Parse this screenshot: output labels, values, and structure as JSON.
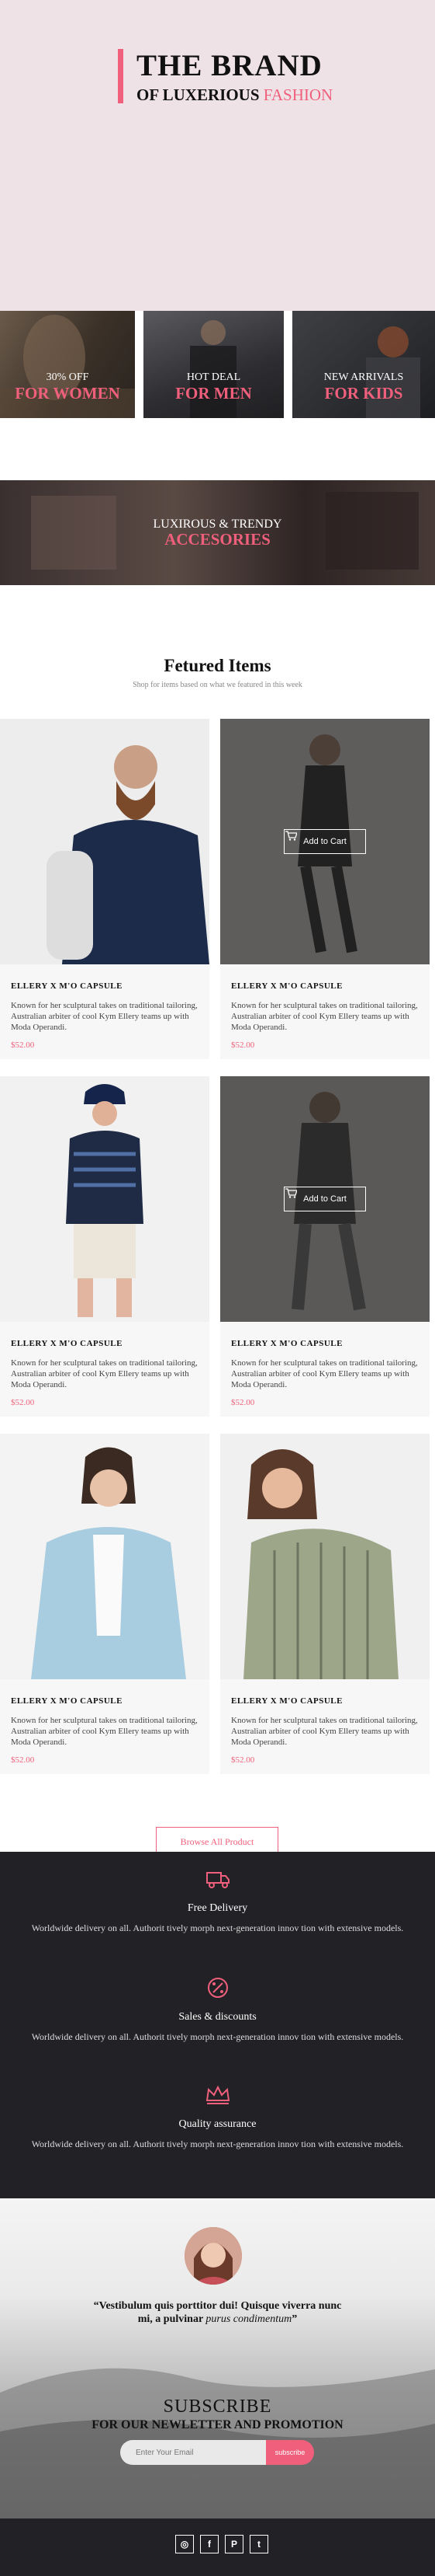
{
  "brand": {
    "title": "THE BRAND",
    "subtitle_prefix": "OF LUXERIOUS ",
    "subtitle_accent": "FASHION"
  },
  "promos": [
    {
      "small": "30% OFF",
      "large": "FOR WOMEN"
    },
    {
      "small": "HOT DEAL",
      "large": "FOR MEN"
    },
    {
      "small": "NEW ARRIVALS",
      "large": "FOR KIDS"
    },
    {
      "small": "LUXIROUS & TRENDY",
      "large": "ACCESORIES"
    }
  ],
  "featured": {
    "title": "Fetured Items",
    "subtitle": "Shop for items based on what we featured in this week"
  },
  "products": [
    {
      "title": "ELLERY X M'O CAPSULE",
      "desc": "Known for her sculptural takes on traditional tailoring, Australian arbiter of cool Kym Ellery teams up with Moda Operandi.",
      "price": "$52.00"
    },
    {
      "title": "ELLERY X M'O CAPSULE",
      "desc": "Known for her sculptural takes on traditional tailoring, Australian arbiter of cool Kym Ellery teams up with Moda Operandi.",
      "price": "$52.00",
      "cta": "Add to Cart"
    },
    {
      "title": "ELLERY X M'O CAPSULE",
      "desc": "Known for her sculptural takes on traditional tailoring, Australian arbiter of cool Kym Ellery teams up with Moda Operandi.",
      "price": "$52.00"
    },
    {
      "title": "ELLERY X M'O CAPSULE",
      "desc": "Known for her sculptural takes on traditional tailoring, Australian arbiter of cool Kym Ellery teams up with Moda Operandi.",
      "price": "$52.00",
      "cta": "Add to Cart"
    },
    {
      "title": "ELLERY X M'O CAPSULE",
      "desc": "Known for her sculptural takes on traditional tailoring, Australian arbiter of cool Kym Ellery teams up with Moda Operandi.",
      "price": "$52.00"
    },
    {
      "title": "ELLERY X M'O CAPSULE",
      "desc": "Known for her sculptural takes on traditional tailoring, Australian arbiter of cool Kym Ellery teams up with Moda Operandi.",
      "price": "$52.00"
    }
  ],
  "browse_label": "Browse All Product",
  "features": [
    {
      "icon": "truck-icon",
      "title": "Free Delivery",
      "text": "Worldwide delivery on all. Authorit tively morph next-generation innov tion with extensive models."
    },
    {
      "icon": "percent-icon",
      "title": "Sales & discounts",
      "text": "Worldwide delivery on all. Authorit tively morph next-generation innov tion with extensive models."
    },
    {
      "icon": "crown-icon",
      "title": "Quality assurance",
      "text": "Worldwide delivery on all. Authorit tively morph next-generation innov tion with extensive models."
    }
  ],
  "testimonial": {
    "quote_main": "“Vestibulum quis porttitor dui! Quisque viverra nunc mi, a pulvinar ",
    "quote_italic": "purus condimentum",
    "quote_end": "”"
  },
  "subscribe": {
    "title": "SUBSCRIBE",
    "subtitle": "FOR OUR NEWLETTER AND PROMOTION",
    "placeholder": "Enter Your Email",
    "button": "subscribe"
  },
  "social": {
    "instagram": "◎",
    "facebook": "f",
    "pinterest": "P",
    "twitter": "t"
  },
  "colors": {
    "accent": "#f0607c",
    "dark": "#222226",
    "hero_bg": "#efe2e6"
  }
}
